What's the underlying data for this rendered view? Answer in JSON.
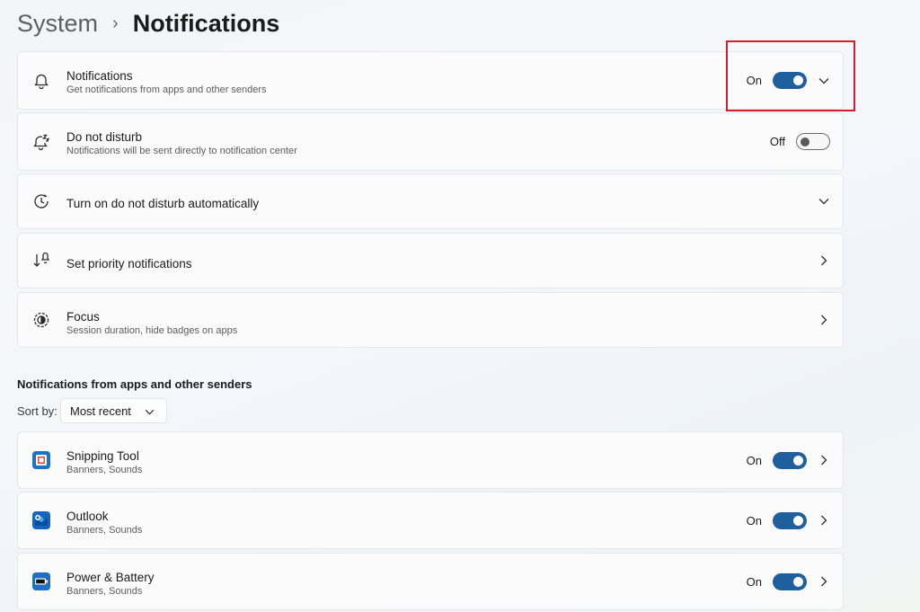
{
  "breadcrumb": {
    "parent": "System",
    "separator": "›",
    "current": "Notifications"
  },
  "settings": [
    {
      "title": "Notifications",
      "subtitle": "Get notifications from apps and other senders",
      "state": "On",
      "icon": "bell-icon",
      "trailing": "chevron-down"
    },
    {
      "title": "Do not disturb",
      "subtitle": "Notifications will be sent directly to notification center",
      "state": "Off",
      "icon": "bell-snooze-icon"
    },
    {
      "title": "Turn on do not disturb automatically",
      "icon": "clock-icon",
      "trailing": "chevron-down"
    },
    {
      "title": "Set priority notifications",
      "icon": "priority-sort-icon",
      "trailing": "chevron-right"
    },
    {
      "title": "Focus",
      "subtitle": "Session duration, hide badges on apps",
      "icon": "focus-icon",
      "trailing": "chevron-right"
    }
  ],
  "apps_section": {
    "title": "Notifications from apps and other senders",
    "sort_label": "Sort by:",
    "sort_value": "Most recent"
  },
  "apps": [
    {
      "name": "Snipping Tool",
      "detail": "Banners, Sounds",
      "state": "On",
      "icon": "snipping-tool-icon"
    },
    {
      "name": "Outlook",
      "detail": "Banners, Sounds",
      "state": "On",
      "icon": "outlook-icon"
    },
    {
      "name": "Power & Battery",
      "detail": "Banners, Sounds",
      "state": "On",
      "icon": "battery-icon"
    }
  ],
  "colors": {
    "accent": "#1f5f9e",
    "highlight": "#d01f2a"
  }
}
